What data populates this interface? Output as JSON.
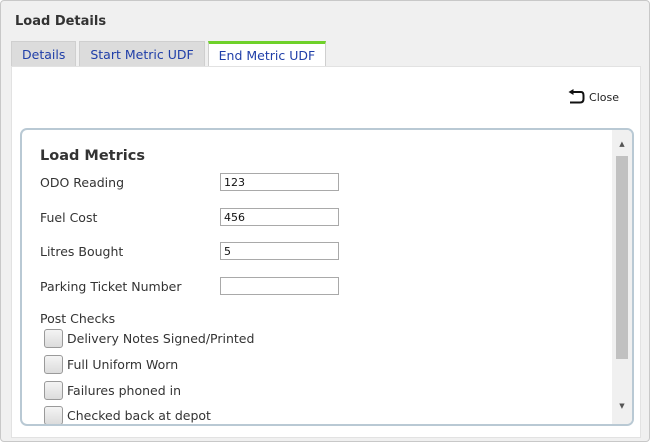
{
  "dialog": {
    "title": "Load Details"
  },
  "tabs": [
    {
      "label": "Details",
      "active": false
    },
    {
      "label": "Start Metric UDF",
      "active": false
    },
    {
      "label": "End Metric UDF",
      "active": true
    }
  ],
  "actions": {
    "close_label": "Close",
    "close_icon": "undo-arrow-icon"
  },
  "panel": {
    "title": "Load Metrics",
    "fields": [
      {
        "label": "ODO Reading",
        "value": "123"
      },
      {
        "label": "Fuel Cost",
        "value": "456"
      },
      {
        "label": "Litres Bought",
        "value": "5"
      },
      {
        "label": "Parking Ticket Number",
        "value": ""
      }
    ],
    "checks_label": "Post Checks",
    "checks": [
      {
        "label": "Delivery Notes Signed/Printed"
      },
      {
        "label": "Full Uniform Worn"
      },
      {
        "label": "Failures phoned in"
      },
      {
        "label": "Checked back at depot"
      }
    ]
  },
  "colors": {
    "tab_accent": "#6fd12a",
    "tab_text": "#1f3ea8",
    "panel_border": "#b9c9d4"
  }
}
